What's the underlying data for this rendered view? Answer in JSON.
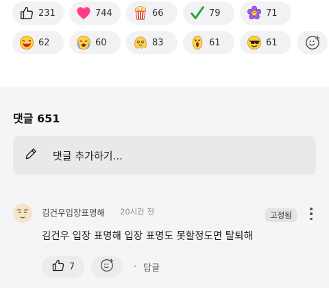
{
  "reactions": [
    {
      "icon": "thumbs-up-icon",
      "count": "231"
    },
    {
      "icon": "heart-icon",
      "count": "744"
    },
    {
      "icon": "popcorn-icon",
      "count": "66"
    },
    {
      "icon": "check-icon",
      "count": "79"
    },
    {
      "icon": "flower-icon",
      "count": "71"
    },
    {
      "icon": "laughing-face-icon",
      "count": "62"
    },
    {
      "icon": "crying-face-icon",
      "count": "60"
    },
    {
      "icon": "melting-face-icon",
      "count": "83"
    },
    {
      "icon": "surprised-face-icon",
      "count": "61"
    },
    {
      "icon": "sunglasses-face-icon",
      "count": "61"
    }
  ],
  "comments_section": {
    "title": "댓글 651",
    "input_placeholder": "댓글 추가하기..."
  },
  "comment": {
    "author": "김건우입장표명해",
    "time": "20시간 전",
    "pinned_label": "고정됨",
    "text": "김건우 입장 표명해 입장 표명도 못할정도면 탈퇴해",
    "like_count": "7",
    "dot": "·",
    "reply_label": "답글"
  },
  "colors": {
    "heart": "#ff3d8b",
    "check": "#1eaa3b",
    "flower": "#a15cf0",
    "background_gray": "#f5f5f7"
  }
}
